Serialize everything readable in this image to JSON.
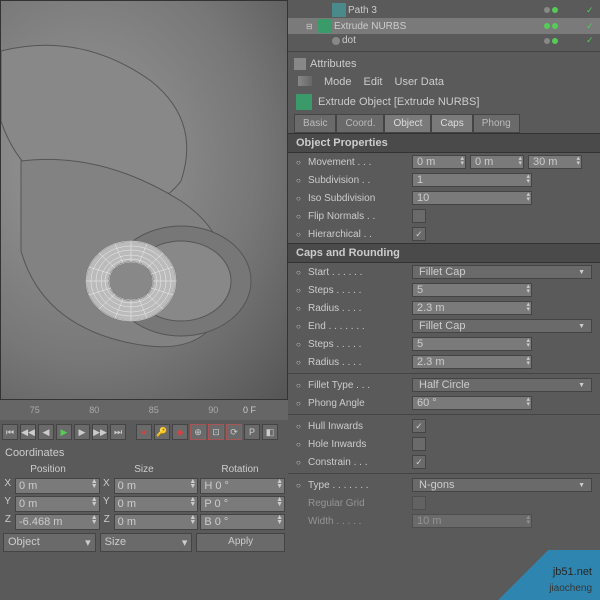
{
  "tree": {
    "items": [
      {
        "name": "Path 3",
        "type": "path"
      },
      {
        "name": "Extrude NURBS",
        "type": "nurbs",
        "selected": true
      },
      {
        "name": "dot",
        "type": "dot"
      }
    ]
  },
  "attributes": {
    "title": "Attributes",
    "menu": [
      "Mode",
      "Edit",
      "User Data"
    ],
    "object_title": "Extrude Object [Extrude NURBS]",
    "tabs": [
      "Basic",
      "Coord.",
      "Object",
      "Caps",
      "Phong"
    ]
  },
  "sections": {
    "props": "Object Properties",
    "caps": "Caps and Rounding"
  },
  "props": {
    "movement": {
      "label": "Movement . . .",
      "x": "0 m",
      "y": "0 m",
      "z": "30 m"
    },
    "subdivision": {
      "label": "Subdivision . .",
      "value": "1"
    },
    "iso": {
      "label": "Iso Subdivision",
      "value": "10"
    },
    "flip": {
      "label": "Flip Normals . .",
      "checked": false
    },
    "hier": {
      "label": "Hierarchical . .",
      "checked": true
    }
  },
  "caps": {
    "start": {
      "label": "Start . . . . . .",
      "value": "Fillet Cap"
    },
    "steps1": {
      "label": "Steps . . . . .",
      "value": "5"
    },
    "radius1": {
      "label": "Radius . . . .",
      "value": "2.3 m"
    },
    "end": {
      "label": "End . . . . . . .",
      "value": "Fillet Cap"
    },
    "steps2": {
      "label": "Steps . . . . .",
      "value": "5"
    },
    "radius2": {
      "label": "Radius . . . .",
      "value": "2.3 m"
    },
    "fillet": {
      "label": "Fillet Type . . .",
      "value": "Half Circle"
    },
    "phong": {
      "label": "Phong Angle",
      "value": "60 °"
    },
    "hull": {
      "label": "Hull Inwards",
      "checked": true
    },
    "hole": {
      "label": "Hole Inwards",
      "checked": false
    },
    "constrain": {
      "label": "Constrain . . .",
      "checked": true
    },
    "type": {
      "label": "Type . . . . . . .",
      "value": "N-gons"
    },
    "grid": {
      "label": "Regular Grid",
      "checked": false
    },
    "width": {
      "label": "Width . . . . .",
      "value": "10 m"
    }
  },
  "timeline": {
    "ticks": [
      "75",
      "80",
      "85",
      "90"
    ],
    "frame": "0 F"
  },
  "coords": {
    "title": "Coordinates",
    "headers": [
      "Position",
      "Size",
      "Rotation"
    ],
    "rows": [
      {
        "axis": "X",
        "pos": "0 m",
        "size": "0 m",
        "rot": "H 0 °"
      },
      {
        "axis": "Y",
        "pos": "0 m",
        "size": "0 m",
        "rot": "P 0 °"
      },
      {
        "axis": "Z",
        "pos": "-6.468 m",
        "size": "0 m",
        "rot": "B 0 °"
      }
    ],
    "mode1": "Object",
    "mode2": "Size",
    "apply": "Apply"
  },
  "watermark": {
    "t1": "jb51.net",
    "t2": "jiaocheng"
  }
}
